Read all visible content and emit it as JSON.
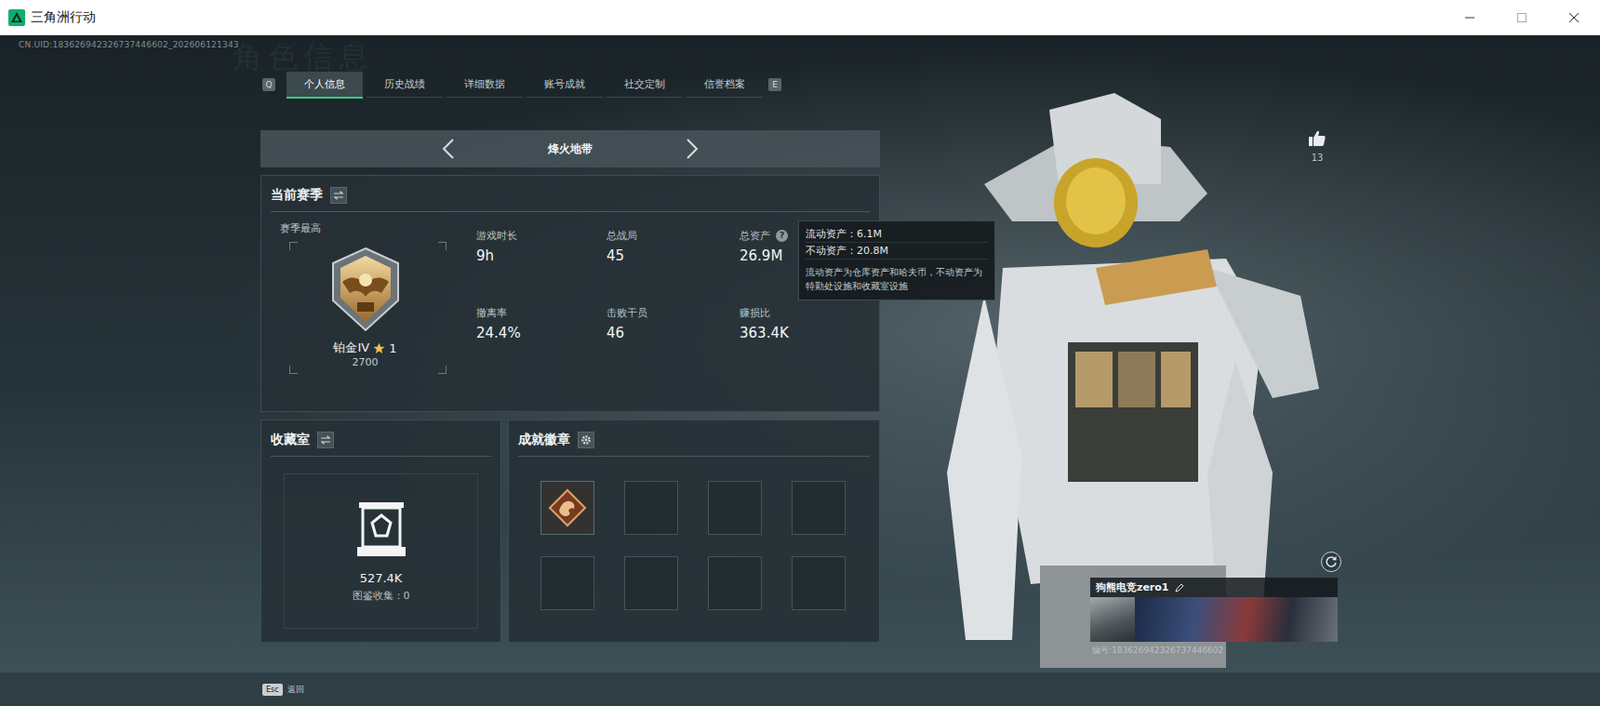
{
  "window": {
    "title": "三角洲行动"
  },
  "uid": "CN.UID:183626942326737446602_202606121343",
  "heading_watermark": "角色信息",
  "tab_keys": {
    "prev": "Q",
    "next": "E"
  },
  "tabs": [
    {
      "label": "个人信息",
      "selected": true
    },
    {
      "label": "历史战绩",
      "selected": false
    },
    {
      "label": "详细数据",
      "selected": false
    },
    {
      "label": "账号成就",
      "selected": false
    },
    {
      "label": "社交定制",
      "selected": false
    },
    {
      "label": "信誉档案",
      "selected": false
    }
  ],
  "mode": {
    "label": "烽火地带"
  },
  "season": {
    "title": "当前赛季",
    "best_label": "赛季最高",
    "rank": "铂金IV",
    "stars": "1",
    "score": "2700",
    "stats": [
      {
        "label": "游戏时长",
        "value": "9h",
        "help": false
      },
      {
        "label": "总战局",
        "value": "45",
        "help": false
      },
      {
        "label": "总资产",
        "value": "26.9M",
        "help": true
      },
      {
        "label": "撤离率",
        "value": "24.4%",
        "help": false
      },
      {
        "label": "击败干员",
        "value": "46",
        "help": false
      },
      {
        "label": "赚损比",
        "value": "363.4K",
        "help": false
      }
    ]
  },
  "help_glyph": "?",
  "tooltip": {
    "lines": [
      "流动资产：6.1M",
      "不动资产：20.8M"
    ],
    "note": "流动资产为仓库资产和哈夫币，不动资产为特勤处设施和收藏室设施"
  },
  "collection": {
    "title": "收藏室",
    "value": "527.4K",
    "catalog": "图鉴收集：0"
  },
  "achievements": {
    "title": "成就徽章",
    "slots": [
      {
        "filled": true
      },
      {
        "filled": false
      },
      {
        "filled": false
      },
      {
        "filled": false
      },
      {
        "filled": false
      },
      {
        "filled": false
      },
      {
        "filled": false
      },
      {
        "filled": false
      }
    ]
  },
  "likes": "13",
  "profile": {
    "name": "狗熊电竞zero1",
    "id": "编号:183626942326737446602"
  },
  "footer": {
    "key": "Esc",
    "label": "返回"
  }
}
